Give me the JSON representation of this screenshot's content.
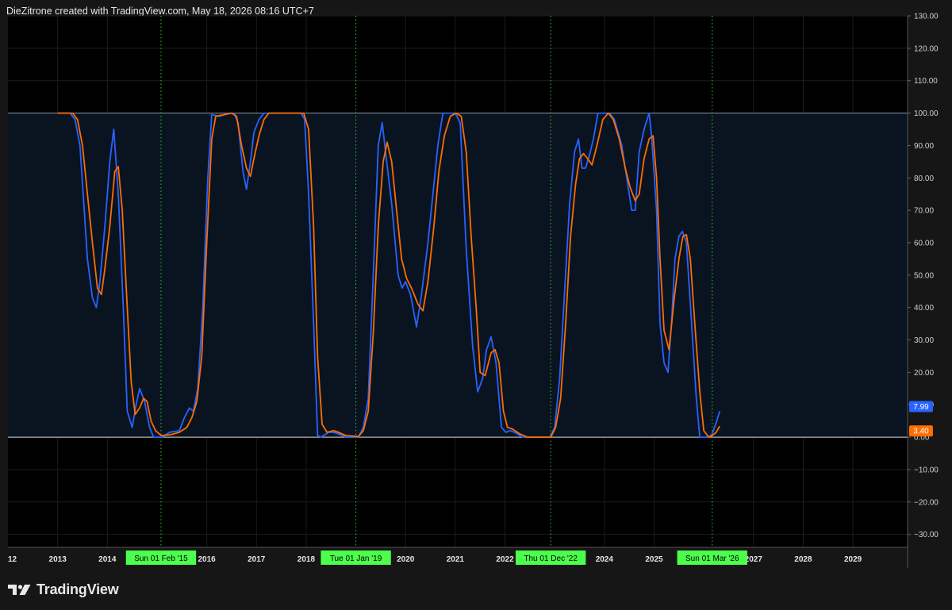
{
  "header": {
    "attribution": "DieZitrone created with TradingView.com, May 18, 2026 08:16 UTC+7"
  },
  "footer": {
    "brand": "TradingView",
    "logo_icon": "tradingview-logo-icon"
  },
  "colors": {
    "chart_bg": "#000000",
    "band_fill": "#0a1420",
    "band_line": "#8a949e",
    "blue": "#2962ff",
    "orange": "#ff6d00",
    "marker_bg": "#4cff4c",
    "grid": "#1c1c1c"
  },
  "chart_data": {
    "type": "line",
    "ylim": [
      -34,
      130
    ],
    "xlim": [
      2012,
      2030.1
    ],
    "y_ticks": [
      "130.00",
      "120.00",
      "110.00",
      "100.00",
      "90.00",
      "80.00",
      "70.00",
      "60.00",
      "50.00",
      "40.00",
      "30.00",
      "20.00",
      "10.00",
      "0.00",
      "−10.00",
      "−20.00",
      "−30.00"
    ],
    "x_ticks": [
      {
        "x": 2012,
        "label": "12"
      },
      {
        "x": 2013,
        "label": "2013"
      },
      {
        "x": 2014,
        "label": "2014"
      },
      {
        "x": 2016,
        "label": "2016"
      },
      {
        "x": 2017,
        "label": "2017"
      },
      {
        "x": 2018,
        "label": "2018"
      },
      {
        "x": 2020,
        "label": "2020"
      },
      {
        "x": 2021,
        "label": "2021"
      },
      {
        "x": 2022,
        "label": "2022"
      },
      {
        "x": 2024,
        "label": "2024"
      },
      {
        "x": 2025,
        "label": "2025"
      },
      {
        "x": 2027,
        "label": "2027"
      },
      {
        "x": 2028,
        "label": "2028"
      },
      {
        "x": 2029,
        "label": "2029"
      }
    ],
    "markers": [
      {
        "x": 2015.08,
        "label": "Sun 01 Feb '15"
      },
      {
        "x": 2019.0,
        "label": "Tue 01 Jan '19"
      },
      {
        "x": 2022.92,
        "label": "Thu 01 Dec '22"
      },
      {
        "x": 2026.17,
        "label": "Sun 01 Mar '26"
      }
    ],
    "band": {
      "upper": 100,
      "lower": 0
    },
    "series": [
      {
        "color": "#2962ff",
        "last_value_label": "7.99",
        "last_value": 7.99,
        "points": [
          [
            2013.0,
            100
          ],
          [
            2013.25,
            100
          ],
          [
            2013.35,
            98
          ],
          [
            2013.45,
            90
          ],
          [
            2013.6,
            55
          ],
          [
            2013.7,
            43
          ],
          [
            2013.78,
            40
          ],
          [
            2013.85,
            48
          ],
          [
            2013.95,
            65
          ],
          [
            2014.05,
            85
          ],
          [
            2014.13,
            95
          ],
          [
            2014.22,
            75
          ],
          [
            2014.32,
            40
          ],
          [
            2014.4,
            8
          ],
          [
            2014.5,
            3
          ],
          [
            2014.58,
            10
          ],
          [
            2014.65,
            15
          ],
          [
            2014.75,
            11
          ],
          [
            2014.85,
            3
          ],
          [
            2014.93,
            0
          ],
          [
            2015.1,
            0
          ],
          [
            2015.25,
            1.5
          ],
          [
            2015.45,
            2
          ],
          [
            2015.55,
            6
          ],
          [
            2015.65,
            9
          ],
          [
            2015.73,
            8
          ],
          [
            2015.82,
            15
          ],
          [
            2015.92,
            40
          ],
          [
            2016.02,
            80
          ],
          [
            2016.1,
            99.5
          ],
          [
            2016.25,
            99
          ],
          [
            2016.45,
            100
          ],
          [
            2016.55,
            100
          ],
          [
            2016.63,
            97
          ],
          [
            2016.73,
            82
          ],
          [
            2016.8,
            76.5
          ],
          [
            2016.88,
            85
          ],
          [
            2016.95,
            94
          ],
          [
            2017.05,
            98
          ],
          [
            2017.15,
            100
          ],
          [
            2017.9,
            100
          ],
          [
            2017.97,
            98
          ],
          [
            2018.05,
            75
          ],
          [
            2018.15,
            35
          ],
          [
            2018.23,
            0.5
          ],
          [
            2018.3,
            0
          ],
          [
            2018.45,
            1.5
          ],
          [
            2018.55,
            1.5
          ],
          [
            2018.65,
            1
          ],
          [
            2018.8,
            0
          ],
          [
            2019.05,
            0
          ],
          [
            2019.15,
            3
          ],
          [
            2019.25,
            12
          ],
          [
            2019.35,
            50
          ],
          [
            2019.45,
            90
          ],
          [
            2019.53,
            97
          ],
          [
            2019.62,
            85
          ],
          [
            2019.72,
            72
          ],
          [
            2019.85,
            50
          ],
          [
            2019.93,
            46
          ],
          [
            2020.0,
            48
          ],
          [
            2020.1,
            44
          ],
          [
            2020.22,
            34
          ],
          [
            2020.32,
            44
          ],
          [
            2020.45,
            60
          ],
          [
            2020.55,
            75
          ],
          [
            2020.65,
            90
          ],
          [
            2020.75,
            100
          ],
          [
            2020.9,
            100
          ],
          [
            2021.0,
            100
          ],
          [
            2021.1,
            97
          ],
          [
            2021.22,
            58
          ],
          [
            2021.35,
            28
          ],
          [
            2021.45,
            14
          ],
          [
            2021.55,
            18
          ],
          [
            2021.63,
            27
          ],
          [
            2021.72,
            31
          ],
          [
            2021.82,
            23
          ],
          [
            2021.93,
            3
          ],
          [
            2022.02,
            1.5
          ],
          [
            2022.1,
            2
          ],
          [
            2022.2,
            1.5
          ],
          [
            2022.35,
            0
          ],
          [
            2022.9,
            0
          ],
          [
            2023.0,
            3
          ],
          [
            2023.1,
            18
          ],
          [
            2023.2,
            45
          ],
          [
            2023.3,
            72
          ],
          [
            2023.4,
            88
          ],
          [
            2023.48,
            92
          ],
          [
            2023.55,
            83
          ],
          [
            2023.62,
            83
          ],
          [
            2023.7,
            87
          ],
          [
            2023.78,
            92
          ],
          [
            2023.87,
            100
          ],
          [
            2024.0,
            100
          ],
          [
            2024.1,
            100
          ],
          [
            2024.2,
            98
          ],
          [
            2024.35,
            90
          ],
          [
            2024.45,
            80
          ],
          [
            2024.55,
            70
          ],
          [
            2024.62,
            70
          ],
          [
            2024.7,
            88
          ],
          [
            2024.8,
            95
          ],
          [
            2024.9,
            100
          ],
          [
            2024.95,
            93
          ],
          [
            2025.05,
            70
          ],
          [
            2025.12,
            35
          ],
          [
            2025.2,
            23
          ],
          [
            2025.28,
            20
          ],
          [
            2025.35,
            35
          ],
          [
            2025.42,
            55
          ],
          [
            2025.5,
            62
          ],
          [
            2025.57,
            63.5
          ],
          [
            2025.65,
            60
          ],
          [
            2025.75,
            36
          ],
          [
            2025.85,
            12
          ],
          [
            2025.92,
            0
          ],
          [
            2026.03,
            0
          ],
          [
            2026.1,
            0
          ],
          [
            2026.17,
            1
          ],
          [
            2026.25,
            4.5
          ],
          [
            2026.32,
            7.99
          ]
        ]
      },
      {
        "color": "#ff6d00",
        "last_value_label": "3.40",
        "last_value": 3.4,
        "points": [
          [
            2013.0,
            100
          ],
          [
            2013.3,
            100
          ],
          [
            2013.4,
            98
          ],
          [
            2013.5,
            90
          ],
          [
            2013.6,
            75
          ],
          [
            2013.7,
            60
          ],
          [
            2013.8,
            46
          ],
          [
            2013.88,
            44
          ],
          [
            2013.95,
            52
          ],
          [
            2014.05,
            65
          ],
          [
            2014.15,
            82
          ],
          [
            2014.22,
            83.5
          ],
          [
            2014.3,
            70
          ],
          [
            2014.4,
            40
          ],
          [
            2014.48,
            17
          ],
          [
            2014.56,
            7
          ],
          [
            2014.65,
            9
          ],
          [
            2014.73,
            12
          ],
          [
            2014.8,
            11
          ],
          [
            2014.88,
            5
          ],
          [
            2014.97,
            2
          ],
          [
            2015.08,
            0.5
          ],
          [
            2015.25,
            0.7
          ],
          [
            2015.45,
            1.5
          ],
          [
            2015.6,
            3
          ],
          [
            2015.7,
            6
          ],
          [
            2015.8,
            11
          ],
          [
            2015.9,
            25
          ],
          [
            2016.0,
            60
          ],
          [
            2016.1,
            92
          ],
          [
            2016.18,
            99
          ],
          [
            2016.35,
            99.5
          ],
          [
            2016.5,
            100
          ],
          [
            2016.6,
            99
          ],
          [
            2016.7,
            90
          ],
          [
            2016.8,
            83
          ],
          [
            2016.88,
            80.5
          ],
          [
            2016.95,
            86
          ],
          [
            2017.05,
            93
          ],
          [
            2017.15,
            98
          ],
          [
            2017.25,
            100
          ],
          [
            2017.95,
            100
          ],
          [
            2018.05,
            95
          ],
          [
            2018.15,
            65
          ],
          [
            2018.23,
            25
          ],
          [
            2018.32,
            4
          ],
          [
            2018.42,
            1.5
          ],
          [
            2018.55,
            2
          ],
          [
            2018.65,
            1.5
          ],
          [
            2018.8,
            0.5
          ],
          [
            2019.05,
            0.2
          ],
          [
            2019.15,
            2
          ],
          [
            2019.25,
            8
          ],
          [
            2019.35,
            32
          ],
          [
            2019.45,
            65
          ],
          [
            2019.55,
            85
          ],
          [
            2019.63,
            91
          ],
          [
            2019.72,
            85
          ],
          [
            2019.82,
            70
          ],
          [
            2019.92,
            55
          ],
          [
            2020.02,
            49
          ],
          [
            2020.12,
            46
          ],
          [
            2020.25,
            41
          ],
          [
            2020.35,
            39
          ],
          [
            2020.45,
            48
          ],
          [
            2020.57,
            65
          ],
          [
            2020.67,
            82
          ],
          [
            2020.78,
            93
          ],
          [
            2020.9,
            99
          ],
          [
            2021.02,
            100
          ],
          [
            2021.12,
            99
          ],
          [
            2021.22,
            88
          ],
          [
            2021.32,
            62
          ],
          [
            2021.42,
            40
          ],
          [
            2021.5,
            20
          ],
          [
            2021.6,
            19
          ],
          [
            2021.72,
            26
          ],
          [
            2021.8,
            27
          ],
          [
            2021.88,
            23
          ],
          [
            2021.97,
            8
          ],
          [
            2022.05,
            3
          ],
          [
            2022.15,
            2.5
          ],
          [
            2022.3,
            1
          ],
          [
            2022.45,
            0
          ],
          [
            2022.92,
            0
          ],
          [
            2023.02,
            3
          ],
          [
            2023.12,
            12
          ],
          [
            2023.22,
            35
          ],
          [
            2023.32,
            62
          ],
          [
            2023.42,
            78
          ],
          [
            2023.5,
            86
          ],
          [
            2023.58,
            87.5
          ],
          [
            2023.66,
            86
          ],
          [
            2023.75,
            84
          ],
          [
            2023.85,
            90
          ],
          [
            2023.97,
            98
          ],
          [
            2024.08,
            100
          ],
          [
            2024.18,
            98
          ],
          [
            2024.3,
            92
          ],
          [
            2024.42,
            83
          ],
          [
            2024.52,
            77
          ],
          [
            2024.62,
            73
          ],
          [
            2024.7,
            75
          ],
          [
            2024.8,
            86
          ],
          [
            2024.9,
            92
          ],
          [
            2024.98,
            93
          ],
          [
            2025.05,
            80
          ],
          [
            2025.12,
            55
          ],
          [
            2025.2,
            33
          ],
          [
            2025.3,
            27
          ],
          [
            2025.4,
            42
          ],
          [
            2025.5,
            55
          ],
          [
            2025.58,
            62
          ],
          [
            2025.65,
            62.5
          ],
          [
            2025.73,
            55
          ],
          [
            2025.82,
            35
          ],
          [
            2025.92,
            14
          ],
          [
            2026.0,
            2
          ],
          [
            2026.1,
            0
          ],
          [
            2026.17,
            0.5
          ],
          [
            2026.25,
            1.5
          ],
          [
            2026.32,
            3.4
          ]
        ]
      }
    ]
  }
}
